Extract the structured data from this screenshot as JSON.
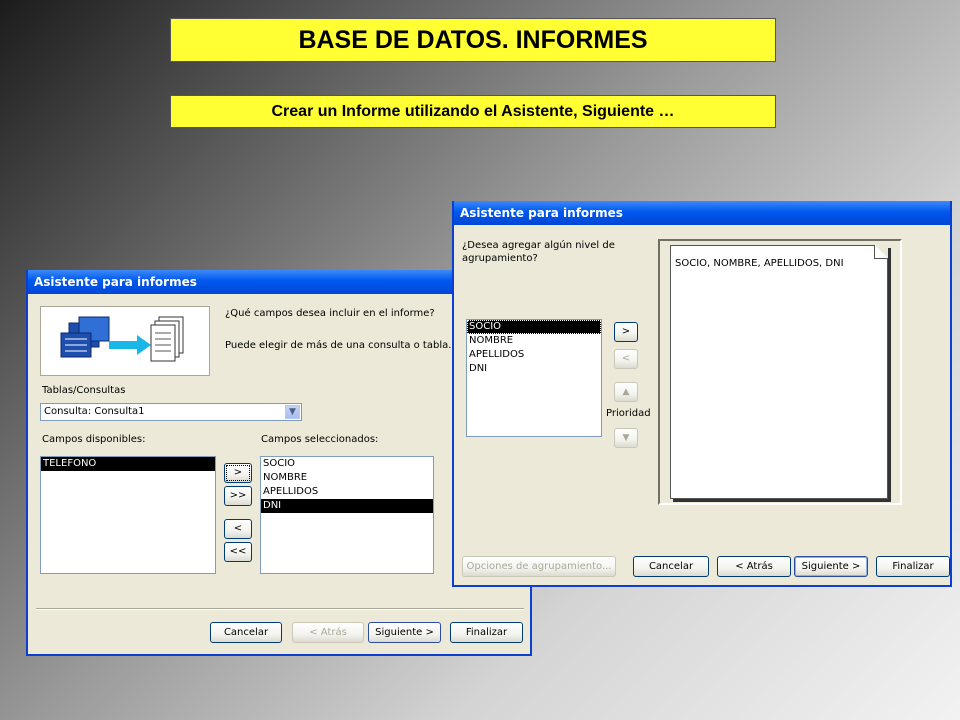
{
  "title": "BASE DE DATOS. INFORMES",
  "subtitle": "Crear un Informe utilizando el Asistente, Siguiente …",
  "dialog1": {
    "title": "Asistente para informes",
    "question": "¿Qué campos desea incluir en el informe?",
    "hint": "Puede elegir de más de una consulta o tabla.",
    "tables_label": "Tablas/Consultas",
    "combo_value": "Consulta: Consulta1",
    "available_label": "Campos disponibles:",
    "selected_label": "Campos seleccionados:",
    "available_fields": [
      "TELEFONO"
    ],
    "selected_fields": [
      "SOCIO",
      "NOMBRE",
      "APELLIDOS",
      "DNI"
    ],
    "move_one": ">",
    "move_all": ">>",
    "remove_one": "<",
    "remove_all": "<<",
    "buttons": {
      "cancel": "Cancelar",
      "back": "< Atrás",
      "next": "Siguiente >",
      "finish": "Finalizar"
    }
  },
  "dialog2": {
    "title": "Asistente para informes",
    "question": "¿Desea agregar algún nivel de agrupamiento?",
    "fields": [
      "SOCIO",
      "NOMBRE",
      "APELLIDOS",
      "DNI"
    ],
    "add": ">",
    "remove": "<",
    "priority_label": "Prioridad",
    "preview_text": "SOCIO, NOMBRE, APELLIDOS, DNI",
    "grouping_options": "Opciones de agrupamiento...",
    "buttons": {
      "cancel": "Cancelar",
      "back": "< Atrás",
      "next": "Siguiente >",
      "finish": "Finalizar"
    }
  }
}
